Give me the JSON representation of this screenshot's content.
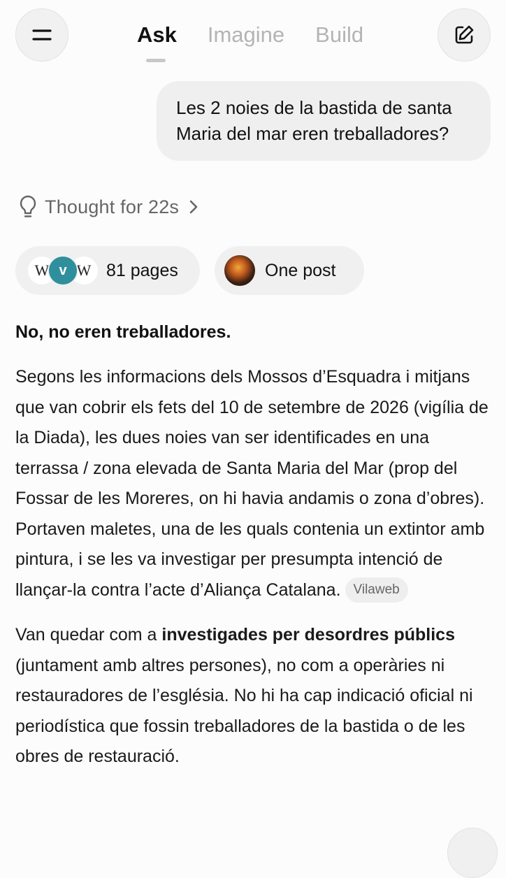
{
  "header": {
    "menu_icon": "menu-icon",
    "edit_icon": "edit-icon",
    "tabs": [
      {
        "label": "Ask",
        "active": true
      },
      {
        "label": "Imagine",
        "active": false
      },
      {
        "label": "Build",
        "active": false
      }
    ]
  },
  "user_message": {
    "line1": "Les 2 noies de la bastida de santa",
    "line2": "Maria del mar eren treballadores?"
  },
  "thought": {
    "icon": "lightbulb-icon",
    "label": "Thought for 22s"
  },
  "sources": {
    "pages_label": "81 pages",
    "post_label": "One post",
    "favicons": [
      "W",
      "v",
      "W"
    ]
  },
  "answer": {
    "heading": "No, no eren treballadores.",
    "para1": "Segons les informacions dels Mossos d’Esquadra i mitjans que van cobrir els fets del 10 de setembre de 2026 (vigília de la Diada), les dues noies van ser identificades en una terrassa / zona elevada de Santa Maria del Mar (prop del Fossar de les Moreres, on hi havia andamis o zona d’obres). Portaven maletes, una de les quals contenia un extintor amb pintura, i se les va investigar per presumpta intenció de llançar-la contra l’acte d’Aliança Catalana.",
    "para1_source": "Vilaweb",
    "para2_prefix": "Van quedar com a ",
    "para2_bold": "investigades per desordres públics",
    "para2_rest": " (juntament amb altres persones), no com a operàries ni restauradores de l’església. No hi ha cap indicació oficial ni periodística que fossin treballadores de la bastida o de les obres de restauració."
  },
  "colors": {
    "background": "#fcfcfc",
    "chip_background": "#f0f0f0",
    "bubble_background": "#efefef",
    "inactive_tab": "#b4b4b4",
    "secondary_text": "#666666"
  }
}
